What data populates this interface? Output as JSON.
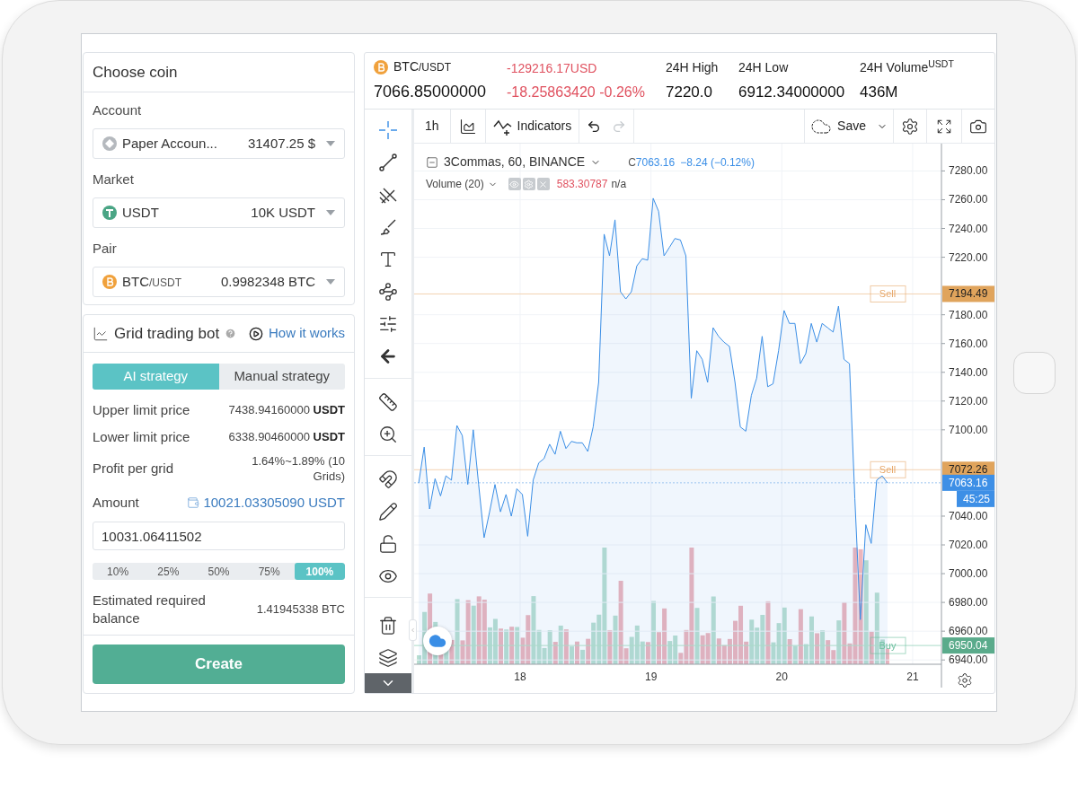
{
  "header": {
    "coin": {
      "base": "BTC",
      "quote": "/USDT"
    },
    "price": "7066.85000000",
    "change_usd": "-129216.17USD",
    "change": "-18.25863420 -0.26%",
    "stats": [
      {
        "label": "24H High",
        "value": "7220.0"
      },
      {
        "label": "24H Low",
        "value": "6912.34000000"
      },
      {
        "label": "24H Volume$^{USDT}$",
        "value": "436M"
      }
    ]
  },
  "choose_coin": {
    "title": "Choose coin",
    "fields": [
      {
        "label": "Account",
        "kind": "account",
        "value": "Paper Accoun...",
        "amount": "31407.25 $"
      },
      {
        "label": "Market",
        "kind": "usdt",
        "value": "USDT",
        "amount": "10K USDT"
      },
      {
        "label": "Pair",
        "kind": "btc",
        "value": "BTC",
        "quote": "/USDT",
        "amount": "0.9982348 BTC"
      }
    ]
  },
  "bot": {
    "title": "Grid trading bot",
    "link": "How it works",
    "tabs": [
      {
        "label": "AI strategy",
        "selected": true
      },
      {
        "label": "Manual strategy",
        "selected": false
      }
    ],
    "rows": [
      {
        "label": "Upper limit price",
        "value": "7438.94160000",
        "unit": "USDT"
      },
      {
        "label": "Lower limit price",
        "value": "6338.90460000",
        "unit": "USDT"
      },
      {
        "label": "Profit per grid",
        "value": "1.64%~1.89% (10 Grids)"
      }
    ],
    "amount": {
      "label": "Amount",
      "available": "10021.03305090 USDT",
      "value": "10031.06411502"
    },
    "percents": [
      {
        "label": "10%",
        "selected": false
      },
      {
        "label": "25%",
        "selected": false
      },
      {
        "label": "50%",
        "selected": false
      },
      {
        "label": "75%",
        "selected": false
      },
      {
        "label": "100%",
        "selected": true
      }
    ],
    "estimate": {
      "label": "Estimated required balance",
      "value": "1.41945338 BTC"
    },
    "create": "Create"
  },
  "chart": {
    "toolbar": {
      "interval": "1h",
      "indicators": "Indicators",
      "save": "Save",
      "redo_disabled": true
    },
    "tool_groups": [
      {
        "tools": [
          {
            "kind": "crosshair",
            "selected": true
          },
          {
            "kind": "line",
            "selected": false
          },
          {
            "kind": "fork",
            "selected": false
          },
          {
            "kind": "brush",
            "selected": false
          },
          {
            "kind": "text",
            "selected": false
          },
          {
            "kind": "pattern",
            "selected": false
          },
          {
            "kind": "fib",
            "selected": false
          },
          {
            "kind": "arrow",
            "selected": false
          }
        ]
      },
      {
        "tools": [
          {
            "kind": "ruler",
            "selected": false
          },
          {
            "kind": "zoom",
            "selected": false
          }
        ]
      },
      {
        "tools": [
          {
            "kind": "magnet",
            "selected": false
          },
          {
            "kind": "pencil_lock",
            "selected": false
          },
          {
            "kind": "lock",
            "selected": false
          },
          {
            "kind": "eye",
            "selected": false
          }
        ]
      },
      {
        "tools": [
          {
            "kind": "trash",
            "selected": false
          },
          {
            "kind": "layers",
            "selected": false
          }
        ]
      }
    ],
    "markers": [
      {
        "kind": "sell",
        "tag": "Sell"
      },
      {
        "kind": "sell",
        "tag": "Sell"
      },
      {
        "kind": "last",
        "countdown": "45:25"
      },
      {
        "kind": "buy",
        "tag": "Buy"
      }
    ],
    "legend": {
      "close_label": "C",
      "close": "7063.16",
      "change": "−8.24 (−0.12%)",
      "volume": "Volume (20)",
      "volume_value": "583.30787",
      "volume_extra": "n/a"
    },
    "chart_data": {
      "type": "area",
      "grid": true,
      "xlim": [
        17.19,
        21.22
      ],
      "ylim": [
        6937,
        7299
      ],
      "xticks": [
        18,
        19,
        20,
        21
      ],
      "yticks": [
        {
          "value": 6940,
          "label": "6940.00"
        },
        {
          "value": 6960,
          "label": "6960.00"
        },
        {
          "value": 6980,
          "label": "6980.00"
        },
        {
          "value": 7000,
          "label": "7000.00"
        },
        {
          "value": 7020,
          "label": "7020.00"
        },
        {
          "value": 7040,
          "label": "7040.00"
        },
        {
          "value": 7100,
          "label": "7100.00"
        },
        {
          "value": 7120,
          "label": "7120.00"
        },
        {
          "value": 7140,
          "label": "7140.00"
        },
        {
          "value": 7160,
          "label": "7160.00"
        },
        {
          "value": 7180,
          "label": "7180.00"
        },
        {
          "value": 7220,
          "label": "7220.00"
        },
        {
          "value": 7240,
          "label": "7240.00"
        },
        {
          "value": 7260,
          "label": "7260.00"
        },
        {
          "value": 7280,
          "label": "7280.00"
        }
      ],
      "x": [
        17.225,
        17.267,
        17.308,
        17.35,
        17.392,
        17.433,
        17.475,
        17.517,
        17.558,
        17.6,
        17.642,
        17.683,
        17.725,
        17.767,
        17.808,
        17.85,
        17.892,
        17.933,
        17.975,
        18.017,
        18.058,
        18.1,
        18.142,
        18.183,
        18.225,
        18.267,
        18.308,
        18.35,
        18.392,
        18.433,
        18.475,
        18.517,
        18.558,
        18.6,
        18.642,
        18.683,
        18.725,
        18.767,
        18.808,
        18.85,
        18.892,
        18.933,
        18.975,
        19.017,
        19.058,
        19.1,
        19.142,
        19.183,
        19.225,
        19.267,
        19.308,
        19.35,
        19.392,
        19.433,
        19.475,
        19.517,
        19.558,
        19.6,
        19.642,
        19.683,
        19.725,
        19.767,
        19.808,
        19.85,
        19.892,
        19.933,
        19.975,
        20.017,
        20.058,
        20.1,
        20.142,
        20.183,
        20.225,
        20.267,
        20.308,
        20.35,
        20.392,
        20.433,
        20.475,
        20.517,
        20.558,
        20.6,
        20.642,
        20.683,
        20.725,
        20.767,
        20.808
      ],
      "series": [
        {
          "name": "3Commas, 60, BINANCE",
          "color": "#3a8ee6",
          "values": [
            7063,
            7088,
            7045,
            7066,
            7054,
            7068,
            7065,
            7103,
            7096,
            7062,
            7100,
            7062,
            7025,
            7043,
            7062,
            7043,
            7055,
            7040,
            7059,
            7055,
            7026,
            7065,
            7077,
            7080,
            7090,
            7083,
            7099,
            7087,
            7092,
            7091,
            7091,
            7085,
            7102,
            7133,
            7236,
            7221,
            7246,
            7196,
            7191,
            7196,
            7214,
            7219,
            7218,
            7261,
            7252,
            7221,
            7227,
            7233,
            7232,
            7221,
            7122,
            7155,
            7149,
            7133,
            7171,
            7165,
            7161,
            7158,
            7133,
            7102,
            7099,
            7124,
            7136,
            7165,
            7130,
            7132,
            7155,
            7183,
            7174,
            7174,
            7146,
            7153,
            7174,
            7161,
            7174,
            7171,
            7168,
            7186,
            7149,
            7146,
            7052,
            6968,
            7034,
            7021,
            7065,
            7068,
            7063
          ]
        }
      ],
      "ref_lines": [
        {
          "axis": "y",
          "value": 7194.49,
          "label": "7194.49",
          "color": "#f3d2b1"
        },
        {
          "axis": "y",
          "value": 7072.26,
          "label": "7072.26",
          "color": "#f3d2b1"
        },
        {
          "axis": "y",
          "value": 7063.16,
          "label": "7063.16",
          "color": "#9cc5f0"
        },
        {
          "axis": "y",
          "value": 6950.04,
          "label": "6950.04",
          "color": "#a9dbc8"
        }
      ]
    }
  }
}
